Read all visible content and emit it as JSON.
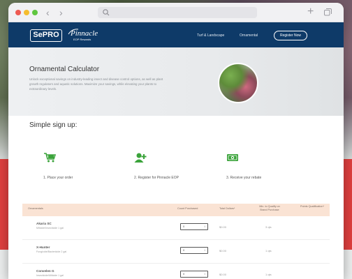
{
  "nav": {
    "turf": "Turf & Landscape",
    "ornamental": "Ornamental",
    "register": "Register Now"
  },
  "logos": {
    "sepro": "SePRO",
    "pinnacle": "Pinnacle",
    "pinnacle_sub": "EOP Rewards"
  },
  "hero": {
    "title": "Ornamental Calculator",
    "description": "Unlock exceptional savings on industry-leading insect and disease control options, as well as plant growth regulators and aquatic solutions. Maximize your savings, while elevating your plants to extraordinary levels."
  },
  "signup": {
    "title": "Simple sign up:",
    "steps": [
      {
        "label": "1. Place your order",
        "icon": "cart-icon"
      },
      {
        "label": "2. Register for Pinnacle EOP",
        "icon": "add-user-icon"
      },
      {
        "label": "3. Receive your rebate",
        "icon": "money-icon"
      }
    ]
  },
  "table": {
    "headers": {
      "product": "Ornamentals",
      "count": "Count Purchased",
      "dollars": "Total Dollars*",
      "minqty": "Min. to Qualify on Brand Purchase",
      "points": "Points Qualification*"
    },
    "rows": [
      {
        "name": "Akaria SC",
        "sub": "Miticide/Insecticide 1 gal",
        "qty": "0",
        "dollars": "$0.00",
        "minqty": "3 qts"
      },
      {
        "name": "X-Hunter",
        "sub": "Fungicide/Bactericide 2 gal",
        "qty": "0",
        "dollars": "$0.00",
        "minqty": "1 qts"
      },
      {
        "name": "Convelen G",
        "sub": "Insecticide/Miticide 1 gal",
        "qty": "0",
        "dollars": "$0.00",
        "minqty": "1 qts"
      }
    ]
  },
  "colors": {
    "header": "#0e3a68",
    "accent_green": "#3aa33a",
    "band_red": "#e2403f",
    "table_head": "#fae3d4"
  }
}
